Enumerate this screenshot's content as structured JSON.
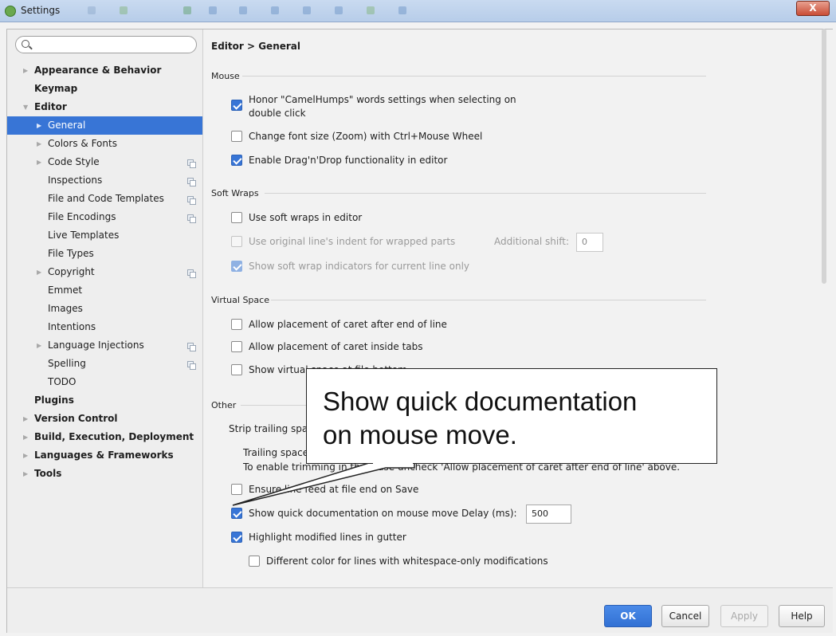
{
  "window": {
    "title": "Settings",
    "close_label": "X"
  },
  "sidebar": {
    "search": {
      "placeholder": ""
    },
    "items": [
      {
        "label": "Appearance & Behavior",
        "bold": true,
        "level": 0,
        "arrow": "right"
      },
      {
        "label": "Keymap",
        "bold": true,
        "level": 0,
        "arrow": ""
      },
      {
        "label": "Editor",
        "bold": true,
        "level": 0,
        "arrow": "down"
      },
      {
        "label": "General",
        "bold": false,
        "level": 1,
        "arrow": "right",
        "selected": true
      },
      {
        "label": "Colors & Fonts",
        "bold": false,
        "level": 1,
        "arrow": "right"
      },
      {
        "label": "Code Style",
        "bold": false,
        "level": 1,
        "arrow": "right",
        "project_icon": true
      },
      {
        "label": "Inspections",
        "bold": false,
        "level": 1,
        "arrow": "",
        "project_icon": true
      },
      {
        "label": "File and Code Templates",
        "bold": false,
        "level": 1,
        "arrow": "",
        "project_icon": true
      },
      {
        "label": "File Encodings",
        "bold": false,
        "level": 1,
        "arrow": "",
        "project_icon": true
      },
      {
        "label": "Live Templates",
        "bold": false,
        "level": 1,
        "arrow": ""
      },
      {
        "label": "File Types",
        "bold": false,
        "level": 1,
        "arrow": ""
      },
      {
        "label": "Copyright",
        "bold": false,
        "level": 1,
        "arrow": "right",
        "project_icon": true
      },
      {
        "label": "Emmet",
        "bold": false,
        "level": 1,
        "arrow": ""
      },
      {
        "label": "Images",
        "bold": false,
        "level": 1,
        "arrow": ""
      },
      {
        "label": "Intentions",
        "bold": false,
        "level": 1,
        "arrow": ""
      },
      {
        "label": "Language Injections",
        "bold": false,
        "level": 1,
        "arrow": "right",
        "project_icon": true
      },
      {
        "label": "Spelling",
        "bold": false,
        "level": 1,
        "arrow": "",
        "project_icon": true
      },
      {
        "label": "TODO",
        "bold": false,
        "level": 1,
        "arrow": ""
      },
      {
        "label": "Plugins",
        "bold": true,
        "level": 0,
        "arrow": ""
      },
      {
        "label": "Version Control",
        "bold": true,
        "level": 0,
        "arrow": "right"
      },
      {
        "label": "Build, Execution, Deployment",
        "bold": true,
        "level": 0,
        "arrow": "right"
      },
      {
        "label": "Languages & Frameworks",
        "bold": true,
        "level": 0,
        "arrow": "right"
      },
      {
        "label": "Tools",
        "bold": true,
        "level": 0,
        "arrow": "right"
      }
    ]
  },
  "main": {
    "breadcrumb": "Editor > General",
    "mouse": {
      "title": "Mouse",
      "camelhumps_line1": "Honor \"CamelHumps\" words settings when selecting on",
      "camelhumps_line2": "double click",
      "camelhumps_checked": true,
      "zoom": "Change font size (Zoom) with Ctrl+Mouse Wheel",
      "zoom_checked": false,
      "dragdrop": "Enable Drag'n'Drop functionality in editor",
      "dragdrop_checked": true
    },
    "soft_wraps": {
      "title": "Soft Wraps",
      "use_soft_wraps": "Use soft wraps in editor",
      "use_soft_wraps_checked": false,
      "original_indent": "Use original line's indent for wrapped parts",
      "original_indent_checked": false,
      "additional_shift_label": "Additional shift:",
      "additional_shift_value": "0",
      "indicators": "Show soft wrap indicators for current line only",
      "indicators_checked": true
    },
    "virtual_space": {
      "title": "Virtual Space",
      "after_end": "Allow placement of caret after end of line",
      "after_end_checked": false,
      "inside_tabs": "Allow placement of caret inside tabs",
      "inside_tabs_checked": false,
      "show_virtual": "Show virtual space at file bottom",
      "show_virtual_checked": false
    },
    "other": {
      "title": "Other",
      "strip_trailing": "Strip trailing spaces on Save:",
      "trailing_note_line1": "Trailing spaces will be trimmed even in the line under caret.",
      "trailing_note_line2": "To enable trimming in that case uncheck 'Allow placement of caret after end of line' above.",
      "ensure_line": "Ensure line feed at file end on Save",
      "ensure_line_checked": false,
      "quick_doc": "Show quick documentation on mouse move",
      "quick_doc_checked": true,
      "delay_label": "Delay (ms):",
      "delay_value": "500",
      "highlight_modified": "Highlight modified lines in gutter",
      "highlight_modified_checked": true,
      "different_color": "Different color for lines with whitespace-only modifications",
      "different_color_checked": false
    }
  },
  "footer": {
    "ok": "OK",
    "cancel": "Cancel",
    "apply": "Apply",
    "help": "Help"
  },
  "callout": {
    "line1": "Show quick documentation",
    "line2": "on mouse move."
  },
  "colors": {
    "selection": "#3875d6",
    "checkbox_checked": "#3875d6",
    "primary_button": "#3271d4"
  }
}
